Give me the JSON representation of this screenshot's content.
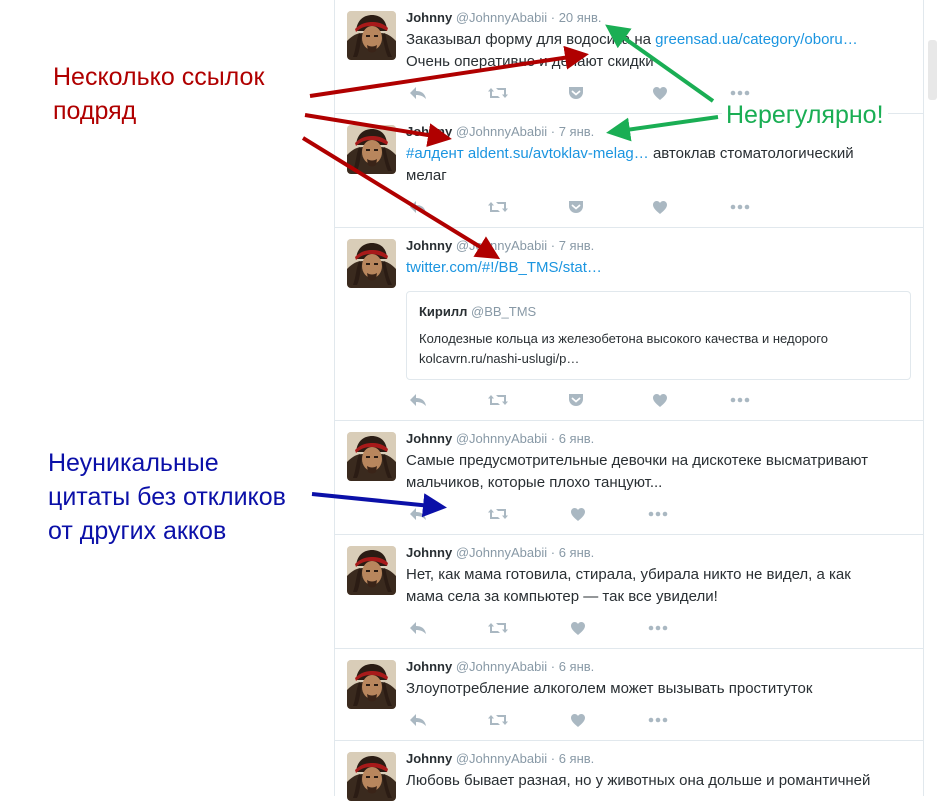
{
  "tweets": [
    {
      "name": "Johnny",
      "handle": "@JohnnyAbabii",
      "date": "· 20 янв.",
      "line1_text": "Заказывал форму для водосика на ",
      "line1_link": "greensad.ua/category/oboru…",
      "line2_text": "Очень оперативно и делают скидки"
    },
    {
      "name": "Johnny",
      "handle": "@JohnnyAbabii",
      "date": "· 7 янв.",
      "line1_link": "#алдент aldent.su/avtoklav-melag…",
      "line1_text": " автоклав стоматологический",
      "line2_text": "мелаг"
    },
    {
      "name": "Johnny",
      "handle": "@JohnnyAbabii",
      "date": "· 7 янв.",
      "line1_link": "twitter.com/#!/BB_TMS/stat…",
      "quote": {
        "name": "Кирилл",
        "handle": "@BB_TMS",
        "line1": "Колодезные кольца из железобетона высокого качества и недорого",
        "line2": "kolcavrn.ru/nashi-uslugi/p…"
      }
    },
    {
      "name": "Johnny",
      "handle": "@JohnnyAbabii",
      "date": "· 6 янв.",
      "line1_text": "Самые предусмотрительные девочки на дискотеке высматривают",
      "line2_text": "мальчиков, которые плохо танцуют..."
    },
    {
      "name": "Johnny",
      "handle": "@JohnnyAbabii",
      "date": "· 6 янв.",
      "line1_text": "Нет, как мама готовила, стирала, убирала никто не видел, а как",
      "line2_text": "мама села за компьютер — так все увидели!"
    },
    {
      "name": "Johnny",
      "handle": "@JohnnyAbabii",
      "date": "· 6 янв.",
      "line1_text": "Злоупотребление алкоголем может вызывать проституток"
    },
    {
      "name": "Johnny",
      "handle": "@JohnnyAbabii",
      "date": "· 6 янв.",
      "line1_text": "Любовь бывает разная, но у животных она дольше и романтичней"
    }
  ],
  "annotations": {
    "links_line1": "Несколько ссылок",
    "links_line2": "подряд",
    "irregular": "Нерегулярно!",
    "quotes_line1": "Неуникальные",
    "quotes_line2": "цитаты без откликов",
    "quotes_line3": "от других акков"
  },
  "icons": {
    "reply": "reply-icon",
    "retweet": "retweet-icon",
    "pocket": "pocket-icon",
    "like": "heart-icon",
    "more": "more-icon"
  },
  "colors": {
    "link": "#1b95e0",
    "red_note": "#b00000",
    "green_note": "#1aae54",
    "blue_note": "#0b10a8",
    "icon": "#aab8c2"
  }
}
